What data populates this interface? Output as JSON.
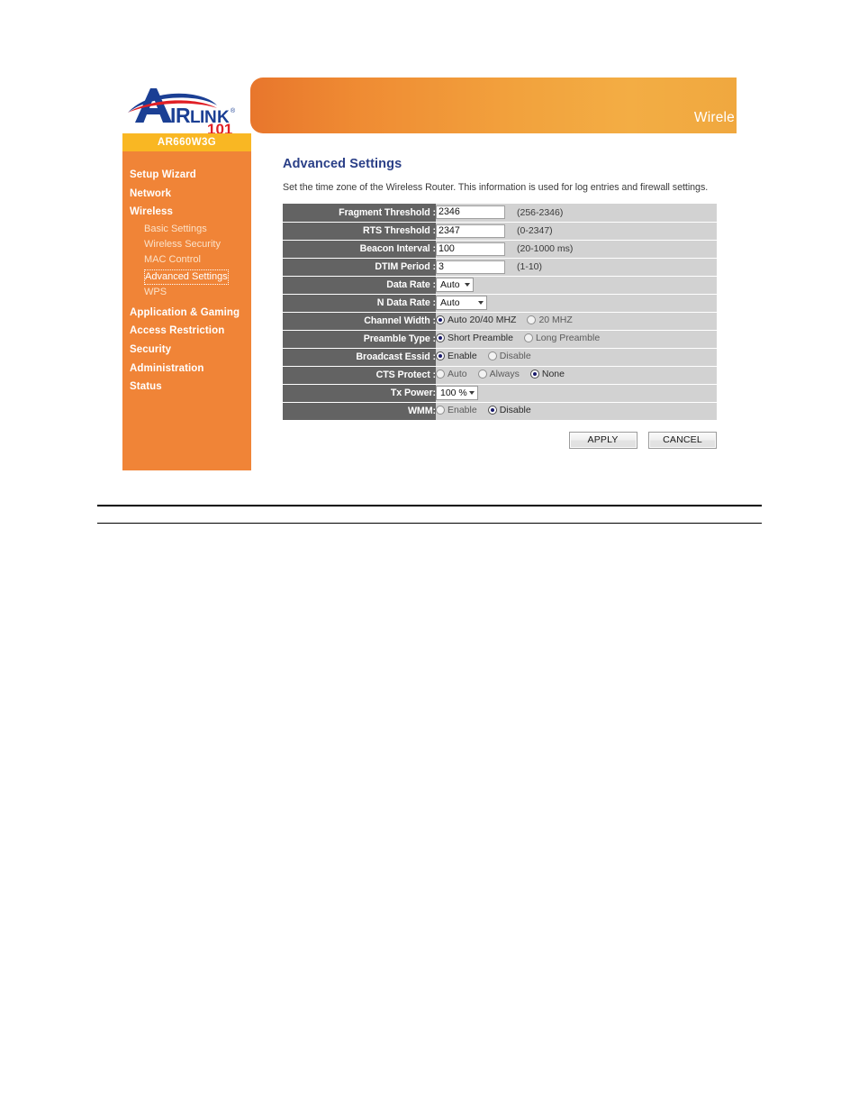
{
  "brand": {
    "logo_text_main": "AIRLINK",
    "logo_text_sub": "101",
    "logo_registered": "®"
  },
  "header": {
    "banner_title": "Wirele"
  },
  "sidebar": {
    "model": "AR660W3G",
    "items": [
      {
        "label": "Setup Wizard",
        "level": "top"
      },
      {
        "label": "Network",
        "level": "top"
      },
      {
        "label": "Wireless",
        "level": "top"
      },
      {
        "label": "Basic Settings",
        "level": "sub"
      },
      {
        "label": "Wireless Security",
        "level": "sub"
      },
      {
        "label": "MAC Control",
        "level": "sub"
      },
      {
        "label": "Advanced Settings",
        "level": "sub",
        "active": true
      },
      {
        "label": "WPS",
        "level": "sub"
      },
      {
        "label": "Application & Gaming",
        "level": "top"
      },
      {
        "label": "Access Restriction",
        "level": "top"
      },
      {
        "label": "Security",
        "level": "top"
      },
      {
        "label": "Administration",
        "level": "top"
      },
      {
        "label": "Status",
        "level": "top"
      }
    ]
  },
  "content": {
    "title": "Advanced Settings",
    "description": "Set the time zone of the Wireless Router. This information is used for log entries and firewall settings.",
    "rows": {
      "fragment_threshold": {
        "label": "Fragment Threshold :",
        "value": "2346",
        "hint": "(256-2346)"
      },
      "rts_threshold": {
        "label": "RTS Threshold :",
        "value": "2347",
        "hint": "(0-2347)"
      },
      "beacon_interval": {
        "label": "Beacon Interval :",
        "value": "100",
        "hint": "(20-1000 ms)"
      },
      "dtim_period": {
        "label": "DTIM Period :",
        "value": "3",
        "hint": "(1-10)"
      },
      "data_rate": {
        "label": "Data Rate :",
        "value": "Auto"
      },
      "n_data_rate": {
        "label": "N Data Rate :",
        "value": "Auto"
      },
      "channel_width": {
        "label": "Channel Width :",
        "options": [
          {
            "label": "Auto 20/40 MHZ",
            "selected": true
          },
          {
            "label": "20 MHZ",
            "selected": false
          }
        ]
      },
      "preamble_type": {
        "label": "Preamble Type :",
        "options": [
          {
            "label": "Short Preamble",
            "selected": true
          },
          {
            "label": "Long Preamble",
            "selected": false
          }
        ]
      },
      "broadcast_essid": {
        "label": "Broadcast Essid :",
        "options": [
          {
            "label": "Enable",
            "selected": true
          },
          {
            "label": "Disable",
            "selected": false
          }
        ]
      },
      "cts_protect": {
        "label": "CTS Protect :",
        "options": [
          {
            "label": "Auto",
            "selected": false
          },
          {
            "label": "Always",
            "selected": false
          },
          {
            "label": "None",
            "selected": true
          }
        ]
      },
      "tx_power": {
        "label": "Tx Power:",
        "value": "100 %"
      },
      "wmm": {
        "label": "WMM:",
        "options": [
          {
            "label": "Enable",
            "selected": false
          },
          {
            "label": "Disable",
            "selected": true
          }
        ]
      }
    },
    "buttons": {
      "apply": "APPLY",
      "cancel": "CANCEL"
    }
  },
  "colors": {
    "sidebar_orange": "#f08437",
    "model_amber": "#f9b723",
    "label_gray": "#636363",
    "value_gray": "#d2d2d2",
    "title_blue": "#2a3f87",
    "logo_blue": "#1b3f94",
    "logo_red": "#e01f26"
  }
}
